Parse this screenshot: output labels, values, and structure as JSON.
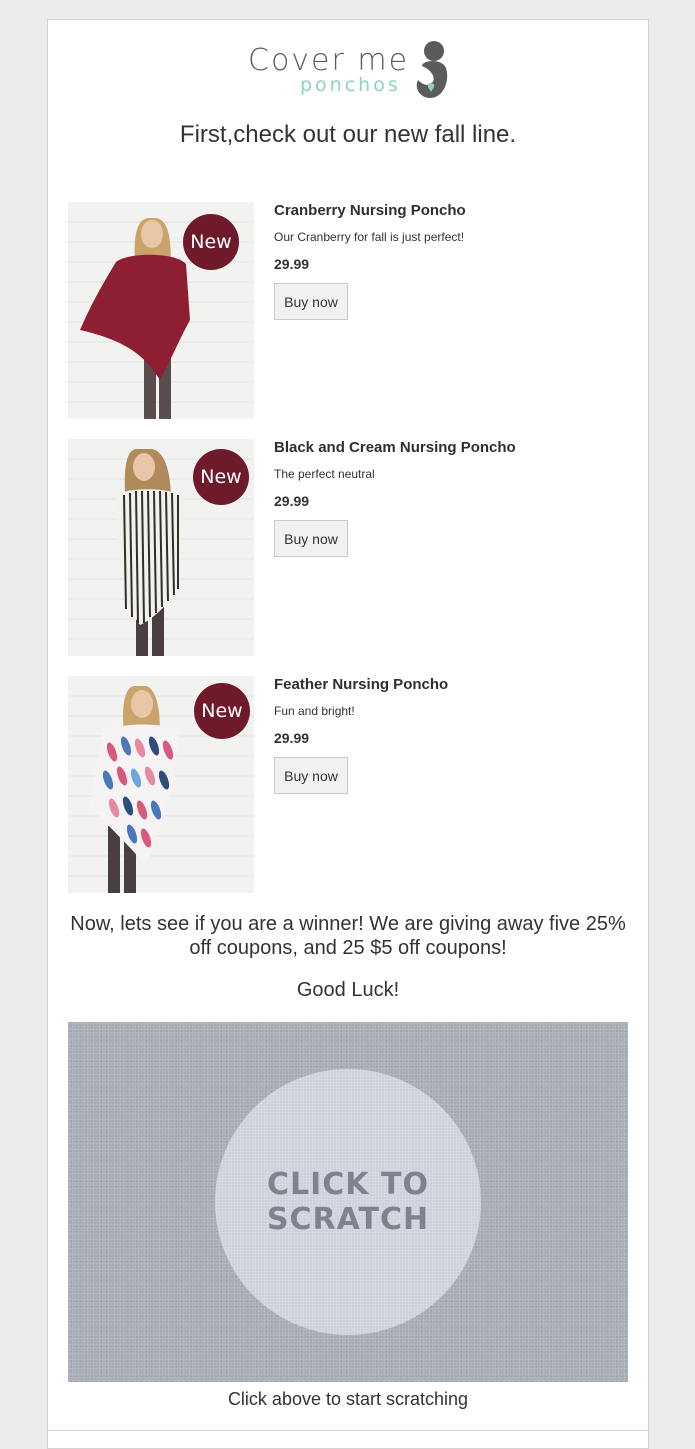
{
  "brand": {
    "logo_word": "Cover me",
    "logo_sub": "ponchos",
    "accent_color": "#8fd1c4",
    "logo_icon": "mother-and-baby-heart-icon"
  },
  "headline": "First,check out our new fall line.",
  "products": [
    {
      "badge": "New",
      "name": "Cranberry Nursing Poncho",
      "description": "Our Cranberry for fall is just perfect!",
      "price": "29.99",
      "button": "Buy now",
      "poncho_color": "#8e1e32"
    },
    {
      "badge": "New",
      "name": "Black and Cream Nursing Poncho",
      "description": "The perfect neutral",
      "price": "29.99",
      "button": "Buy now",
      "poncho_color": "#3c3c3c"
    },
    {
      "badge": "New",
      "name": "Feather Nursing Poncho",
      "description": "Fun and bright!",
      "price": "29.99",
      "button": "Buy now",
      "poncho_color": "#d9597a"
    }
  ],
  "badge_color": "#6e1a2a",
  "promo_text": "Now, lets see if you are a winner! We are giving away five 25% off coupons, and 25 $5 off coupons!",
  "good_luck": "Good Luck!",
  "scratch": {
    "label": "CLICK TO SCRATCH",
    "caption": "Click above to start scratching"
  }
}
